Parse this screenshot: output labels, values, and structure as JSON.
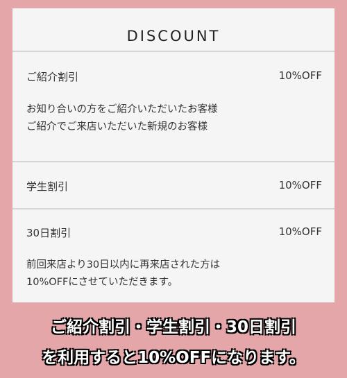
{
  "title": "DISCOUNT",
  "items": [
    {
      "label": "ご紹介割引",
      "value": "10%OFF",
      "desc": "お知り合いの方をご紹介いただいたお客様\nご紹介でご来店いただいた新規のお客様"
    },
    {
      "label": "学生割引",
      "value": "10%OFF",
      "desc": ""
    },
    {
      "label": "30日割引",
      "value": "10%OFF",
      "desc": "前回来店より30日以内に再来店された方は\n10%OFFにさせていただきます。"
    }
  ],
  "caption": {
    "line1": "ご紹介割引・学生割引・30日割引",
    "line2": "を利用すると10%OFFになります。"
  }
}
